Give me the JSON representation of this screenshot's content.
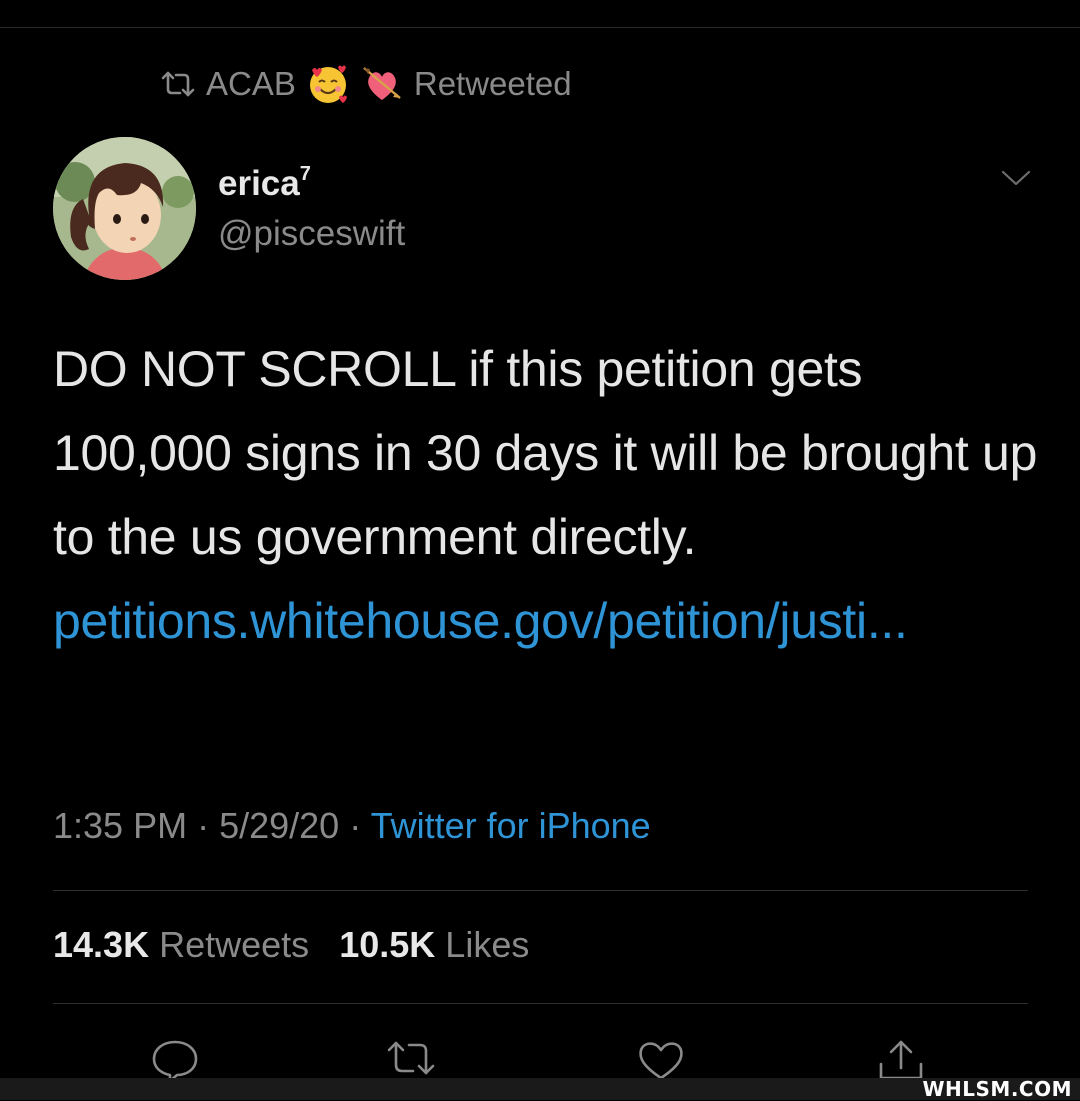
{
  "retweet_header": {
    "user": "ACAB",
    "label": "Retweeted"
  },
  "author": {
    "name": "erica",
    "name_sup": "7",
    "handle": "@pisceswift"
  },
  "tweet": {
    "text": "DO NOT SCROLL if this petition gets 100,000 signs in 30 days it will be brought up to the us government directly. ",
    "link_text": "petitions.whitehouse.gov/petition/justi..."
  },
  "meta": {
    "time": "1:35 PM",
    "date": "5/29/20",
    "source": "Twitter for iPhone"
  },
  "stats": {
    "retweets_count": "14.3K",
    "retweets_label": "Retweets",
    "likes_count": "10.5K",
    "likes_label": "Likes"
  },
  "icons": {
    "retweet_header": "retweet-icon",
    "emoji_1": "smiling-face-with-hearts",
    "emoji_2": "heart-with-arrow",
    "menu": "chevron-down-icon",
    "actions": [
      "reply-icon",
      "retweet-icon",
      "like-icon",
      "share-icon"
    ]
  },
  "watermark": "WHLSM.COM",
  "colors": {
    "background": "#000000",
    "link": "#2f94d6",
    "muted": "#8a8a8a",
    "text": "#e6e6e6"
  }
}
